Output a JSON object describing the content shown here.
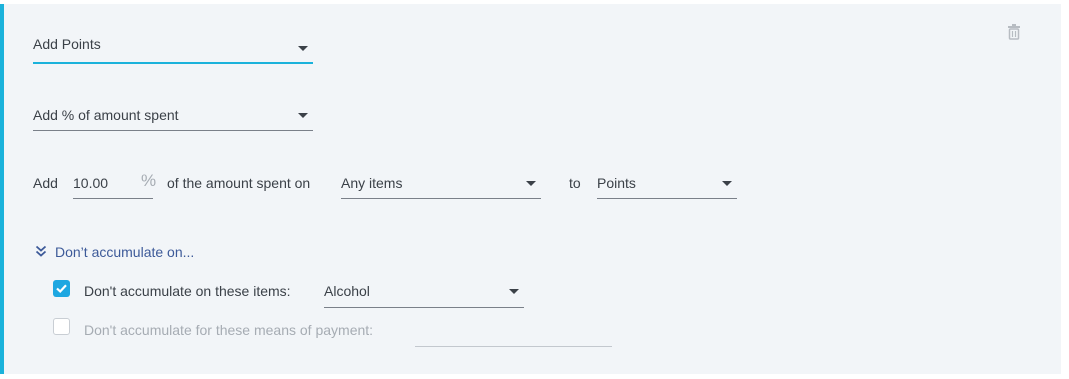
{
  "rule": {
    "action_select": {
      "value": "Add Points"
    },
    "mode_select": {
      "value": "Add % of amount spent"
    },
    "formula": {
      "prefix": "Add",
      "percent_value": "10.00",
      "percent_symbol": "%",
      "middle_text": "of the amount spent on",
      "items_select": "Any items",
      "to_text": "to",
      "target_select": "Points"
    },
    "exclusions": {
      "toggle_label": "Don’t accumulate on...",
      "items_row": {
        "checked": true,
        "label": "Don't accumulate on these items:",
        "select_value": "Alcohol"
      },
      "payment_row": {
        "checked": false,
        "label": "Don't accumulate for these means of payment:",
        "select_value": ""
      }
    }
  },
  "colors": {
    "accent": "#1bb2db",
    "checkbox_checked": "#1ea7e1",
    "link": "#3d5a99",
    "panel_bg": "#f2f5f8"
  },
  "icons": {
    "delete": "trash-icon",
    "toggle": "double-chevron-down-icon",
    "dropdown": "caret-down-icon",
    "check": "checkmark-icon"
  }
}
